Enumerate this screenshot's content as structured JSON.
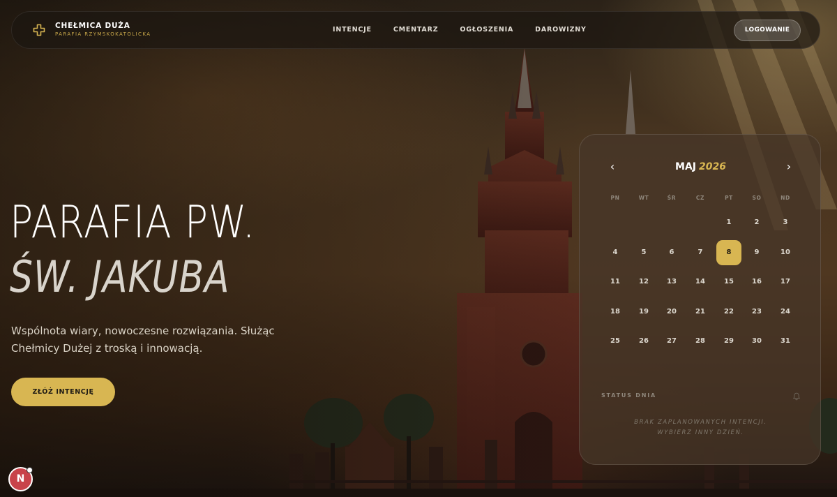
{
  "brand": {
    "name": "CHEŁMICA DUŻA",
    "subtitle": "PARAFIA RZYMSKOKATOLICKA"
  },
  "nav": {
    "items": [
      "INTENCJE",
      "CMENTARZ",
      "OGŁOSZENIA",
      "DAROWIZNY"
    ],
    "login_label": "LOGOWANIE"
  },
  "hero": {
    "line1": "PARAFIA PW.",
    "line2": "ŚW. JAKUBA",
    "description": "Wspólnota wiary, nowoczesne rozwiązania. Służąc Chełmicy Dużej z troską i innowacją.",
    "cta_label": "ZŁÓŻ INTENCJĘ"
  },
  "calendar": {
    "month": "MAJ",
    "year": "2026",
    "weekdays": [
      "PN",
      "WT",
      "ŚR",
      "CZ",
      "PT",
      "SO",
      "ND"
    ],
    "first_weekday_index": 4,
    "days_in_month": 31,
    "selected_day": 8,
    "status_label": "STATUS DNIA",
    "status_message_line1": "BRAK ZAPLANOWANYCH INTENCJI.",
    "status_message_line2": "WYBIERZ INNY DZIEŃ."
  },
  "badge": {
    "letter": "N"
  },
  "colors": {
    "accent": "#d8b652",
    "nav_bg": "#1c1610",
    "selected_day_text": "#231d12"
  },
  "icons": {
    "brand": "cross-icon",
    "prev": "chevron-left-icon",
    "next": "chevron-right-icon",
    "status": "bell-icon"
  }
}
